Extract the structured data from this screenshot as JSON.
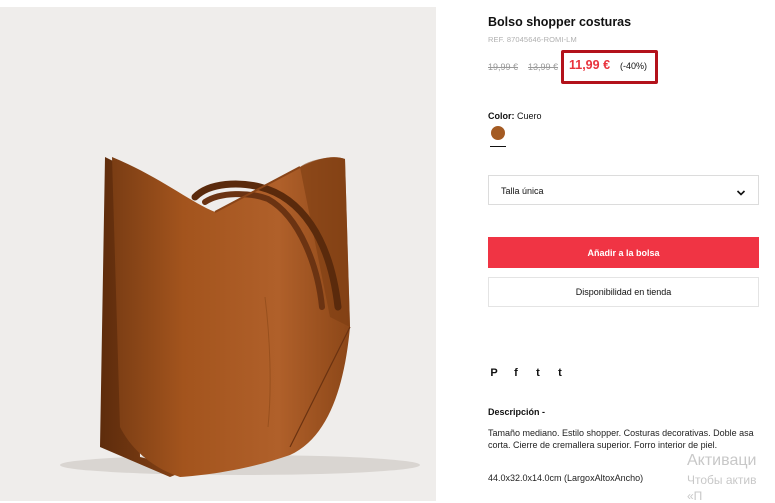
{
  "product": {
    "title": "Bolso shopper costuras",
    "ref": "REF. 87045646-ROMI-LM",
    "price_original": "19,99 €",
    "price_previous": "13,99 €",
    "price_current": "11,99 €",
    "discount": "(-40%)",
    "color_label": "Color:",
    "color_value": "Cuero",
    "swatch_color": "#a45b23",
    "size_label": "Talla única",
    "add_to_bag": "Añadir a la bolsa",
    "availability": "Disponibilidad en tienda",
    "share_icons": [
      "P",
      "f",
      "t",
      "t"
    ],
    "description_heading": "Descripción",
    "description": "Tamaño mediano. Estilo shopper. Costuras decorativas. Doble asa corta. Cierre de cremallera superior. Forro interior de piel.",
    "dimensions": "44.0x32.0x14.0cm (LargoxAltoxAncho)"
  },
  "watermark": {
    "line1": "Активаци",
    "line2": "Чтобы актив",
    "line3": "«П"
  },
  "colors": {
    "accent_red": "#f03444",
    "price_red": "#e8323c",
    "highlight_box": "#b3121b",
    "leather": "#a45b23"
  }
}
